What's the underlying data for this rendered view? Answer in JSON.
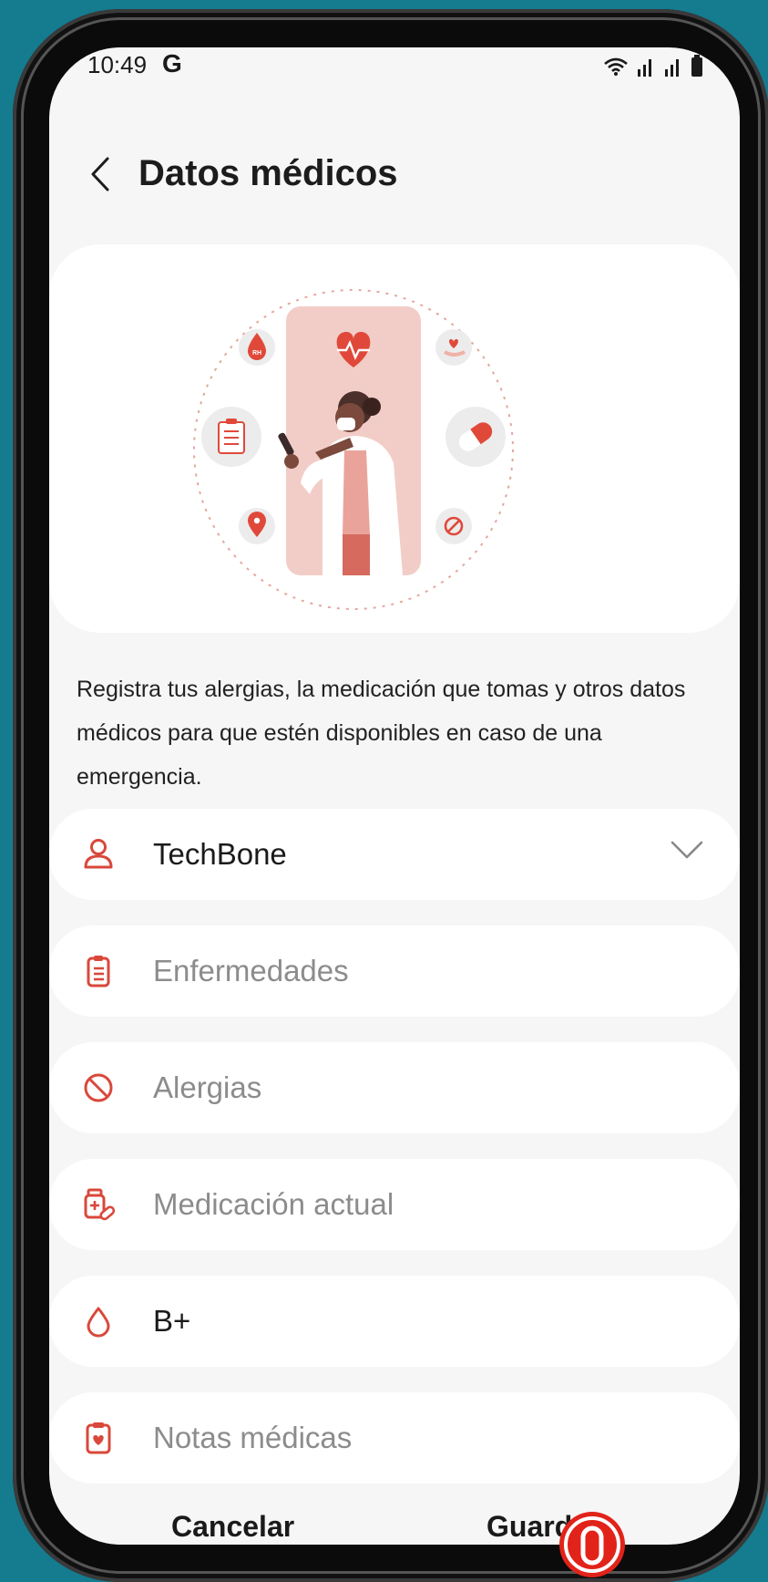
{
  "status_bar": {
    "time": "10:49",
    "carrier_logo": "G",
    "icons": [
      "wifi-icon",
      "signal-icon",
      "signal-icon",
      "battery-icon"
    ]
  },
  "header": {
    "back_icon": "chevron-left-icon",
    "title": "Datos médicos"
  },
  "illustration": {
    "icons": [
      "blood-drop-rh-icon",
      "heart-pulse-icon",
      "hand-heart-icon",
      "clipboard-list-icon",
      "pill-icon",
      "location-pin-icon",
      "prohibited-icon"
    ],
    "badge_text": "RH"
  },
  "description": "Registra tus alergias, la medicación que tomas y otros datos médicos para que estén disponibles en caso de una emergencia.",
  "fields": [
    {
      "icon": "person-icon",
      "label": "TechBone",
      "is_placeholder": false,
      "dropdown": true
    },
    {
      "icon": "clipboard-list-icon",
      "label": "Enfermedades",
      "is_placeholder": true
    },
    {
      "icon": "prohibited-icon",
      "label": "Alergias",
      "is_placeholder": true
    },
    {
      "icon": "medication-icon",
      "label": "Medicación actual",
      "is_placeholder": true
    },
    {
      "icon": "blood-drop-icon",
      "label": "B+",
      "is_placeholder": false
    },
    {
      "icon": "medical-notes-icon",
      "label": "Notas médicas",
      "is_placeholder": true
    }
  ],
  "actions": {
    "cancel": "Cancelar",
    "save": "Guardar"
  },
  "colors": {
    "accent": "#d9483b",
    "background": "#157b8f",
    "screen": "#f6f6f6",
    "card": "#ffffff",
    "placeholder_text": "#8c8c8c"
  }
}
